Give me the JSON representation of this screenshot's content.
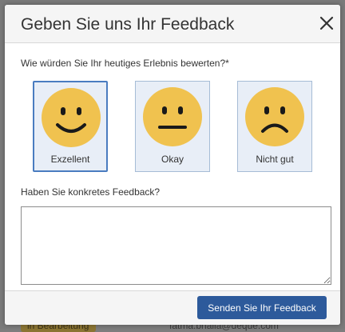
{
  "background": {
    "badge_text": "in Bearbeitung",
    "email_text": "fatma.bhalla@deque.com"
  },
  "dialog": {
    "title": "Geben Sie uns Ihr Feedback",
    "close_icon": "close-icon"
  },
  "rating": {
    "question": "Wie würden Sie Ihr heutiges Erlebnis bewerten?*",
    "selected": "excellent",
    "options": [
      {
        "id": "excellent",
        "label": "Exzellent",
        "icon": "smiley-happy-icon"
      },
      {
        "id": "okay",
        "label": "Okay",
        "icon": "smiley-neutral-icon"
      },
      {
        "id": "not-good",
        "label": "Nicht gut",
        "icon": "smiley-sad-icon"
      }
    ]
  },
  "feedback": {
    "label": "Haben Sie konkretes Feedback?",
    "value": ""
  },
  "footer": {
    "submit_label": "Senden Sie Ihr Feedback"
  },
  "colors": {
    "accent": "#2d5a9b",
    "selected_border": "#4a7cc0",
    "option_bg": "#e8eef7",
    "smiley_fill": "#f0c24f"
  }
}
